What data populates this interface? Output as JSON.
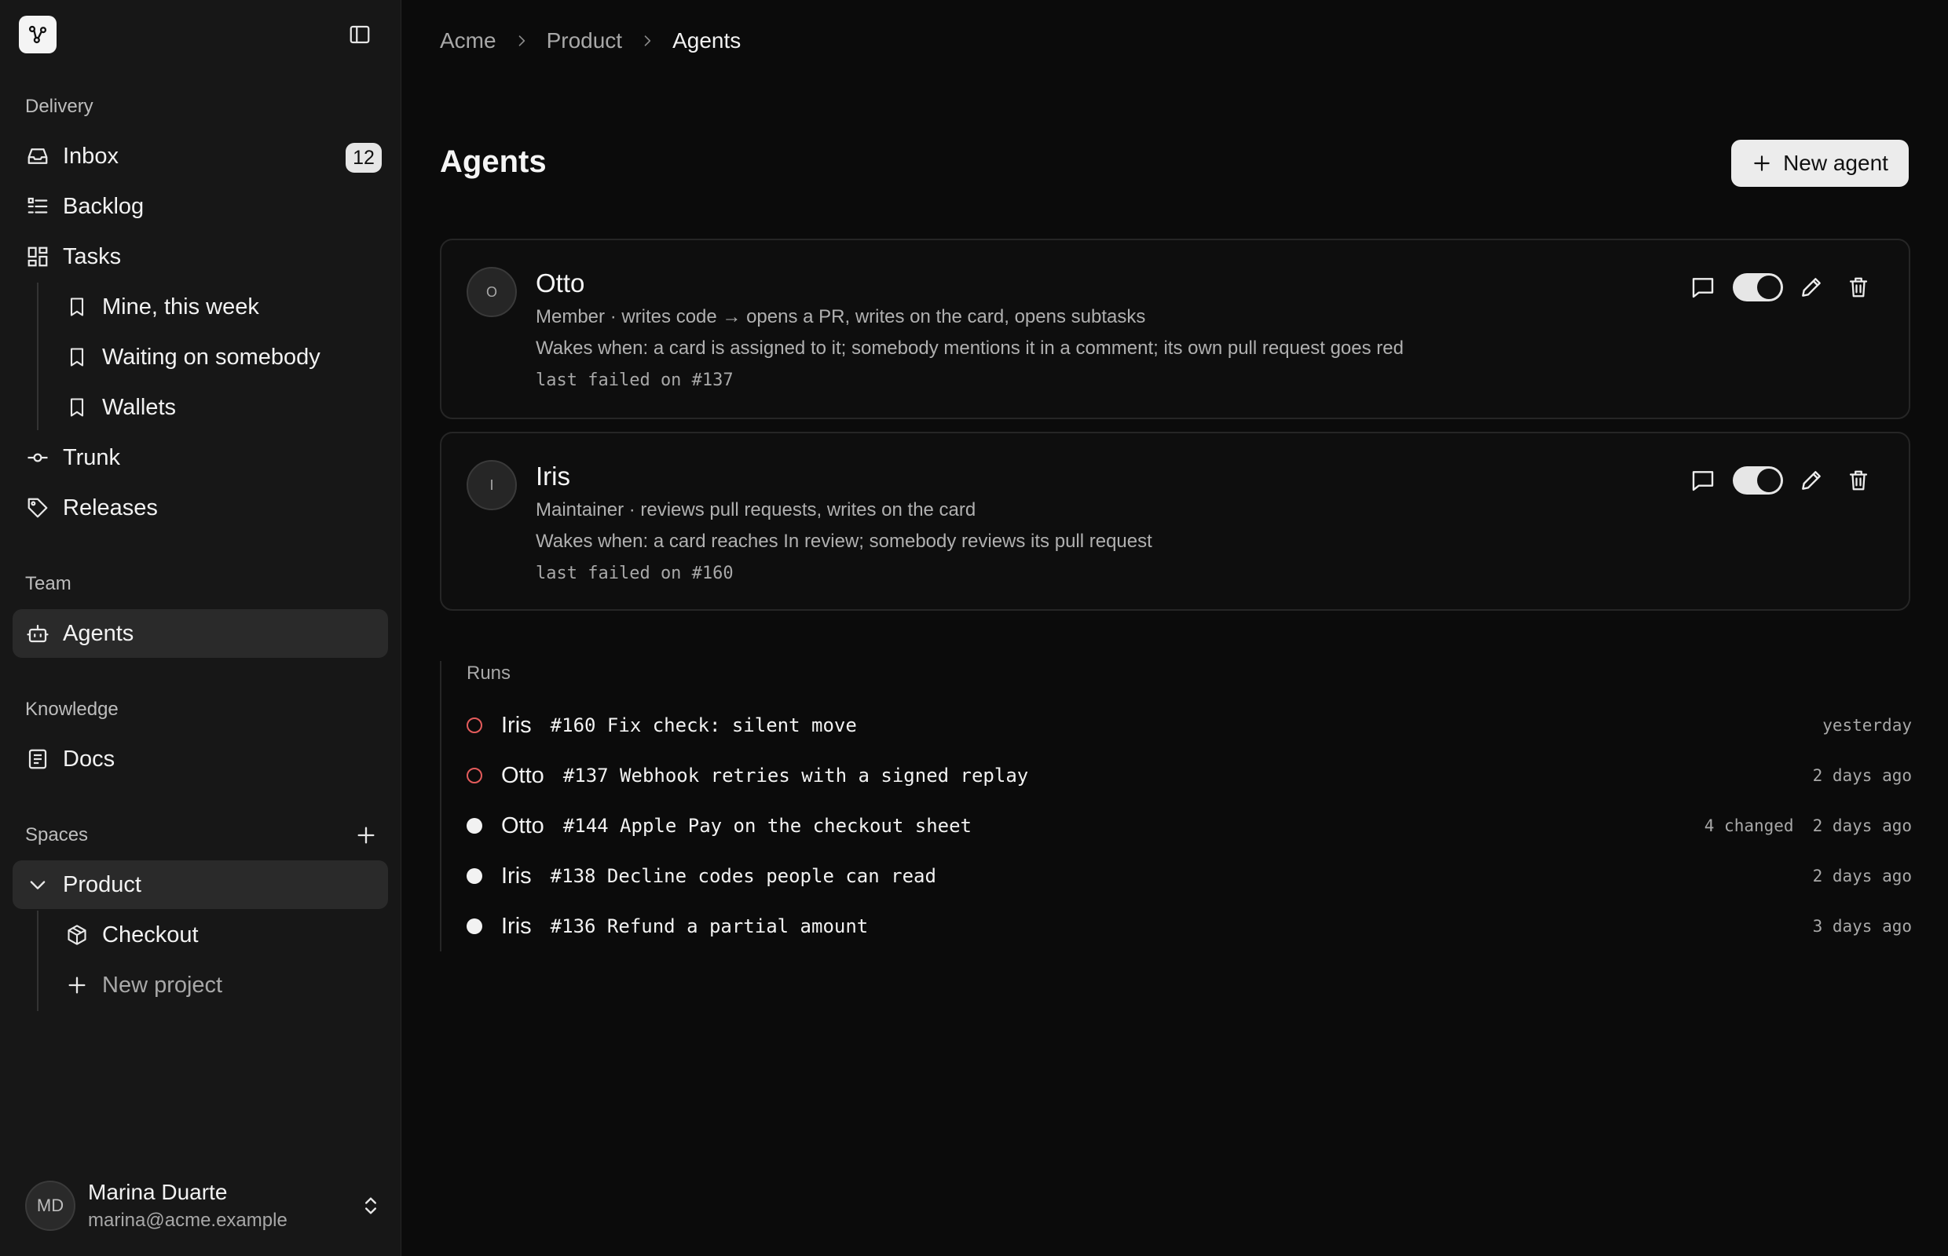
{
  "sidebar": {
    "sections": {
      "delivery": "Delivery",
      "team": "Team",
      "knowledge": "Knowledge",
      "spaces": "Spaces"
    },
    "items": {
      "inbox": {
        "label": "Inbox",
        "badge": "12",
        "icon": "inbox-icon"
      },
      "backlog": {
        "label": "Backlog",
        "icon": "list-check-icon"
      },
      "tasks": {
        "label": "Tasks",
        "icon": "layout-grid-icon"
      },
      "mine": {
        "label": "Mine, this week",
        "icon": "bookmark-icon"
      },
      "waiting": {
        "label": "Waiting on somebody",
        "icon": "bookmark-icon"
      },
      "wallets": {
        "label": "Wallets",
        "icon": "bookmark-icon"
      },
      "trunk": {
        "label": "Trunk",
        "icon": "git-commit-icon"
      },
      "releases": {
        "label": "Releases",
        "icon": "tag-icon"
      },
      "agents": {
        "label": "Agents",
        "icon": "bot-icon"
      },
      "docs": {
        "label": "Docs",
        "icon": "book-icon"
      },
      "product": {
        "label": "Product",
        "icon": "chevron-down-icon"
      },
      "checkout": {
        "label": "Checkout",
        "icon": "package-icon"
      },
      "new_project": {
        "label": "New project",
        "icon": "plus-icon"
      }
    },
    "user": {
      "initials": "MD",
      "name": "Marina Duarte",
      "email": "marina@acme.example"
    }
  },
  "breadcrumb": {
    "items": [
      "Acme",
      "Product",
      "Agents"
    ]
  },
  "page": {
    "title": "Agents",
    "new_agent_label": "New agent"
  },
  "agents": [
    {
      "initial": "O",
      "name": "Otto",
      "role": "Member · writes code → opens a PR, writes on the card, opens subtasks",
      "wakes": "Wakes when: a card is assigned to it; somebody mentions it in a comment; its own pull request goes red",
      "last_failed": "last failed on #137",
      "enabled": true
    },
    {
      "initial": "I",
      "name": "Iris",
      "role": "Maintainer · reviews pull requests, writes on the card",
      "wakes": "Wakes when: a card reaches In review; somebody reviews its pull request",
      "last_failed": "last failed on #160",
      "enabled": true
    }
  ],
  "runs": {
    "label": "Runs",
    "items": [
      {
        "status": "failed",
        "agent": "Iris",
        "title": "#160 Fix check: silent move",
        "changed": "",
        "time": "yesterday"
      },
      {
        "status": "failed",
        "agent": "Otto",
        "title": "#137 Webhook retries with a signed replay",
        "changed": "",
        "time": "2 days ago"
      },
      {
        "status": "ok",
        "agent": "Otto",
        "title": "#144 Apple Pay on the checkout sheet",
        "changed": "4 changed",
        "time": "2 days ago"
      },
      {
        "status": "ok",
        "agent": "Iris",
        "title": "#138 Decline codes people can read",
        "changed": "",
        "time": "2 days ago"
      },
      {
        "status": "ok",
        "agent": "Iris",
        "title": "#136 Refund a partial amount",
        "changed": "",
        "time": "3 days ago"
      }
    ]
  },
  "colors": {
    "background": "#0b0b0b",
    "sidebar": "#171717",
    "failed": "#e45c5c",
    "accent_button": "#ececec"
  }
}
